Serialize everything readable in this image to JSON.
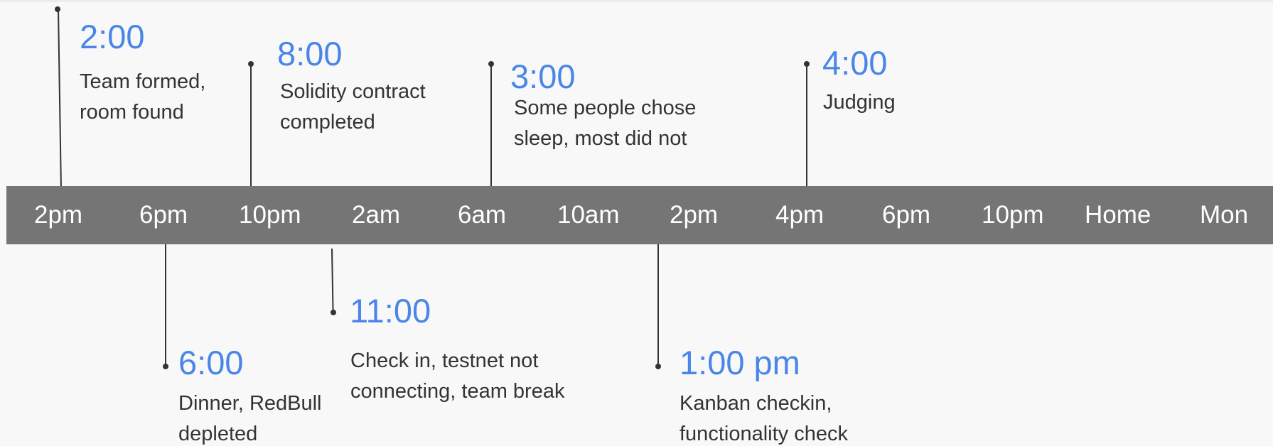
{
  "timeline": {
    "ticks": [
      "2pm",
      "6pm",
      "10pm",
      "2am",
      "6am",
      "10am",
      "2pm",
      "4pm",
      "6pm",
      "10pm",
      "Home",
      "Mon"
    ],
    "bar_color": "#757575",
    "accent_color": "#4a86e8",
    "text_color": "#333333"
  },
  "events": [
    {
      "time": "2:00",
      "desc_line1": "Team formed,",
      "desc_line2": "room found"
    },
    {
      "time": "8:00",
      "desc_line1": "Solidity contract",
      "desc_line2": "completed"
    },
    {
      "time": "3:00",
      "desc_line1": "Some people chose",
      "desc_line2": "sleep, most did not"
    },
    {
      "time": "4:00",
      "desc_line1": "Judging",
      "desc_line2": ""
    },
    {
      "time": "6:00",
      "desc_line1": "Dinner, RedBull",
      "desc_line2": "depleted"
    },
    {
      "time": "11:00",
      "desc_line1": "Check in, testnet not",
      "desc_line2": "connecting, team break"
    },
    {
      "time": "1:00 pm",
      "desc_line1": "Kanban checkin,",
      "desc_line2": "functionality check"
    }
  ]
}
